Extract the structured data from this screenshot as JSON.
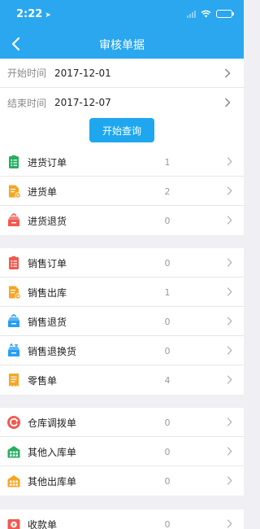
{
  "status_bar": {
    "time": "2:22",
    "location_icon": "location-arrow-icon"
  },
  "nav": {
    "title": "审核单据",
    "back_icon": "chevron-left-icon"
  },
  "date_filter": {
    "start_label": "开始时间",
    "start_value": "2017-12-01",
    "end_label": "结束时间",
    "end_value": "2017-12-07",
    "query_button": "开始查询"
  },
  "colors": {
    "header": "#2aa7ef",
    "button": "#1ea7ef",
    "background": "#efeff4"
  },
  "groups": [
    {
      "items": [
        {
          "label": "进货订单",
          "count": "1",
          "icon": "clipboard-list-icon",
          "color": "#27ae60"
        },
        {
          "label": "进货单",
          "count": "2",
          "icon": "document-add-icon",
          "color": "#f5a623"
        },
        {
          "label": "进货退货",
          "count": "0",
          "icon": "box-return-icon",
          "color": "#f05a4f"
        }
      ]
    },
    {
      "items": [
        {
          "label": "销售订单",
          "count": "0",
          "icon": "clipboard-list-icon",
          "color": "#f05a4f"
        },
        {
          "label": "销售出库",
          "count": "1",
          "icon": "document-out-icon",
          "color": "#f5a623"
        },
        {
          "label": "销售退货",
          "count": "0",
          "icon": "box-return-icon",
          "color": "#2a9df4"
        },
        {
          "label": "销售退换货",
          "count": "0",
          "icon": "box-exchange-icon",
          "color": "#2a9df4"
        },
        {
          "label": "零售单",
          "count": "4",
          "icon": "receipt-icon",
          "color": "#f5a623"
        }
      ]
    },
    {
      "items": [
        {
          "label": "仓库调拨单",
          "count": "0",
          "icon": "transfer-circle-icon",
          "color": "#f05a4f"
        },
        {
          "label": "其他入库单",
          "count": "0",
          "icon": "warehouse-in-icon",
          "color": "#27ae60"
        },
        {
          "label": "其他出库单",
          "count": "0",
          "icon": "warehouse-out-icon",
          "color": "#f5a623"
        }
      ]
    },
    {
      "items": [
        {
          "label": "收款单",
          "count": "0",
          "icon": "payment-icon",
          "color": "#f05a4f"
        }
      ]
    }
  ]
}
